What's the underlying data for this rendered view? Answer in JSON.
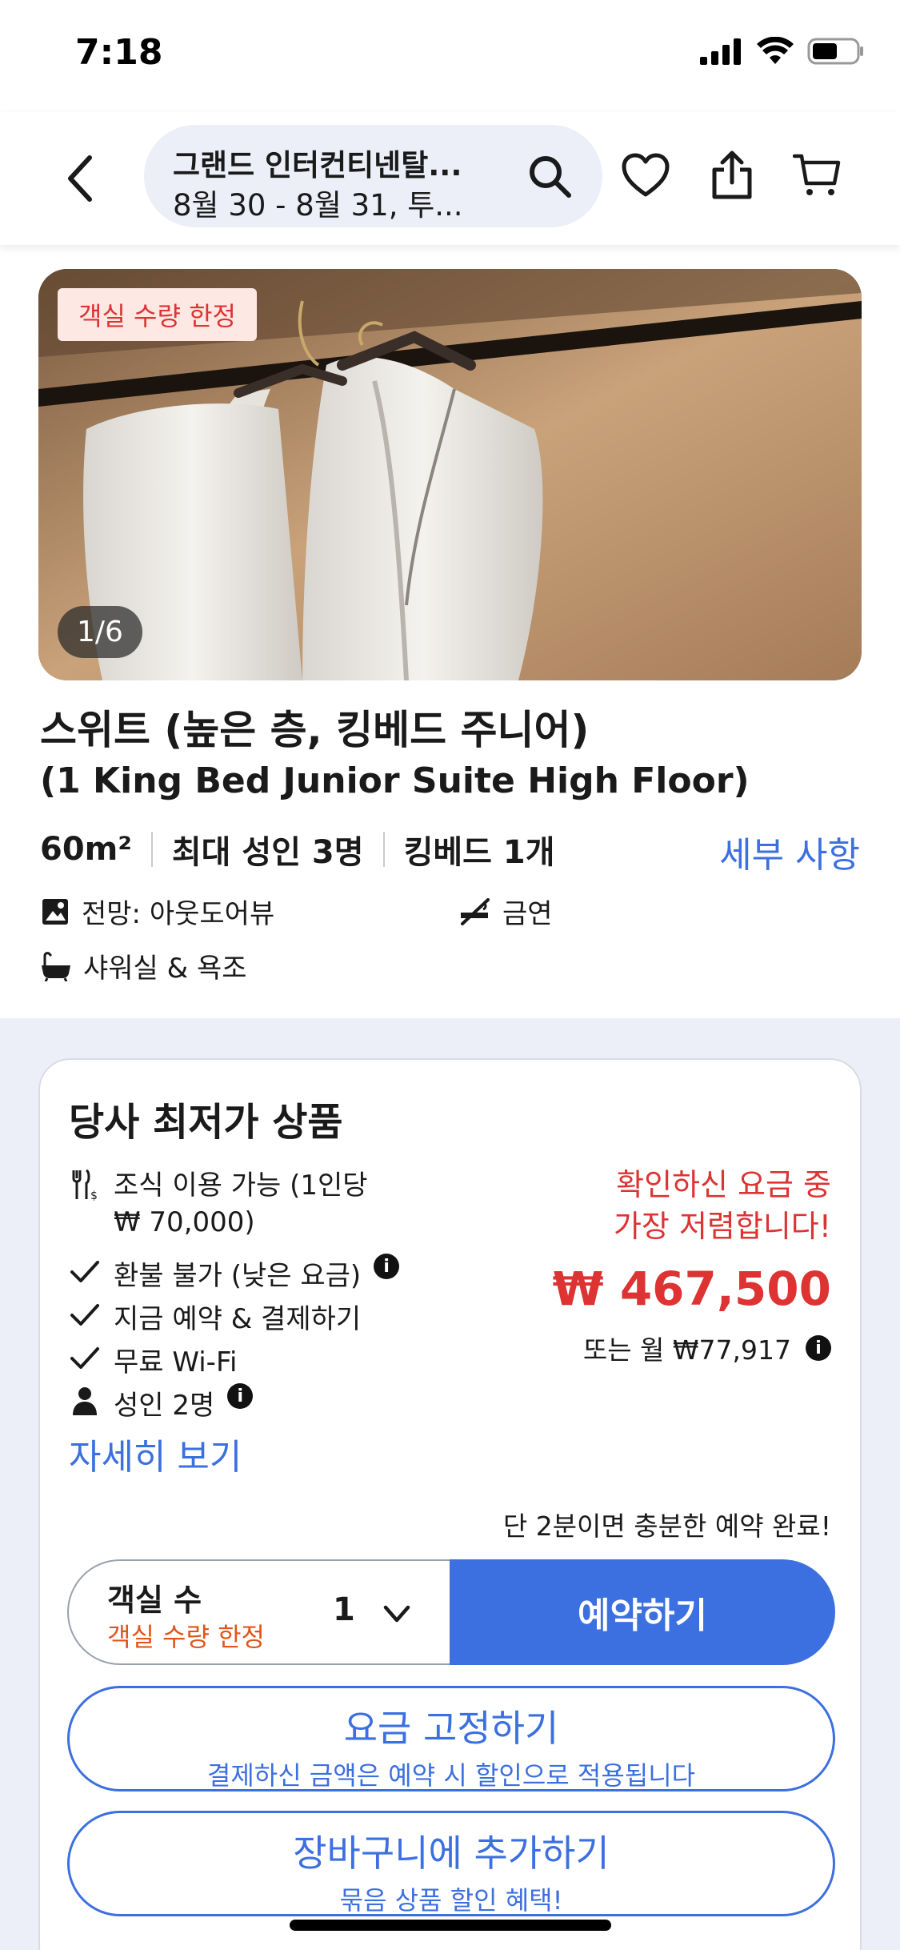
{
  "status_bar": {
    "time": "7:18"
  },
  "header": {
    "search_title": "그랜드 인터컨티넨탈...",
    "search_subtitle": "8월 30 - 8월 31, 투..."
  },
  "photo": {
    "badge": "객실 수량 한정",
    "counter": "1/6"
  },
  "room": {
    "title": "스위트 (높은 층, 킹베드 주니어)",
    "subtitle": "(1 King Bed Junior Suite High Floor)",
    "specs": [
      "60m²",
      "최대 성인 3명",
      "킹베드 1개"
    ],
    "details_link": "세부 사항",
    "features": {
      "view": "전망: 아웃도어뷰",
      "smoking": "금연",
      "bath": "샤워실 & 욕조"
    }
  },
  "offer": {
    "title": "당사 최저가 상품",
    "inclusions": [
      {
        "icon": "breakfast-icon",
        "text": "조식 이용 가능 (1인당",
        "text2": "₩ 70,000)"
      },
      {
        "icon": "check-icon",
        "text": "환불 불가 (낮은 요금)"
      },
      {
        "icon": "check-icon",
        "text": "지금 예약 & 결제하기"
      },
      {
        "icon": "check-icon",
        "text": "무료 Wi-Fi"
      },
      {
        "icon": "person-icon",
        "text": "성인 2명"
      }
    ],
    "more_link": "자세히 보기",
    "price_note_line1": "확인하신 요금 중",
    "price_note_line2": "가장 저렴합니다!",
    "price": "₩ 467,500",
    "monthly": "또는 월 ₩77,917",
    "quick_note": "단 2분이면 충분한 예약 완료!",
    "room_select_label": "객실 수",
    "room_select_warning": "객실 수량 한정",
    "room_select_value": "1",
    "book_button": "예약하기",
    "lock_button_main": "요금 고정하기",
    "lock_button_sub": "결제하신 금액은 예약 시 할인으로 적용됩니다",
    "cart_button_main": "장바구니에 추가하기",
    "cart_button_sub": "묶음 상품 할인 혜택!"
  },
  "colors": {
    "accent": "#3c6fe0",
    "price_red": "#d33333",
    "warning_orange": "#e0551c",
    "section_bg": "#eceef8"
  }
}
